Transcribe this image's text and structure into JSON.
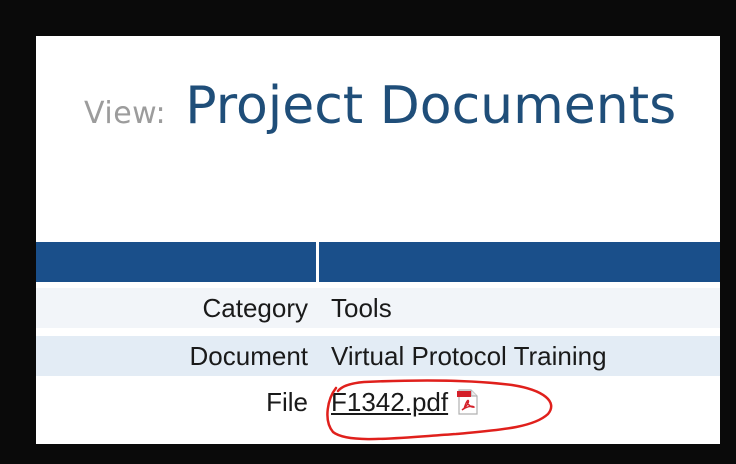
{
  "header": {
    "view_label": "View:",
    "title": "Project Documents"
  },
  "details": {
    "category": {
      "label": "Category",
      "value": "Tools"
    },
    "document": {
      "label": "Document",
      "value": "Virtual Protocol Training"
    },
    "file": {
      "label": "File",
      "value": "F1342.pdf",
      "icon": "pdf-icon"
    }
  },
  "colors": {
    "header_bar": "#1a4f8a",
    "title": "#1f4e79",
    "annotation": "#e0201c"
  }
}
